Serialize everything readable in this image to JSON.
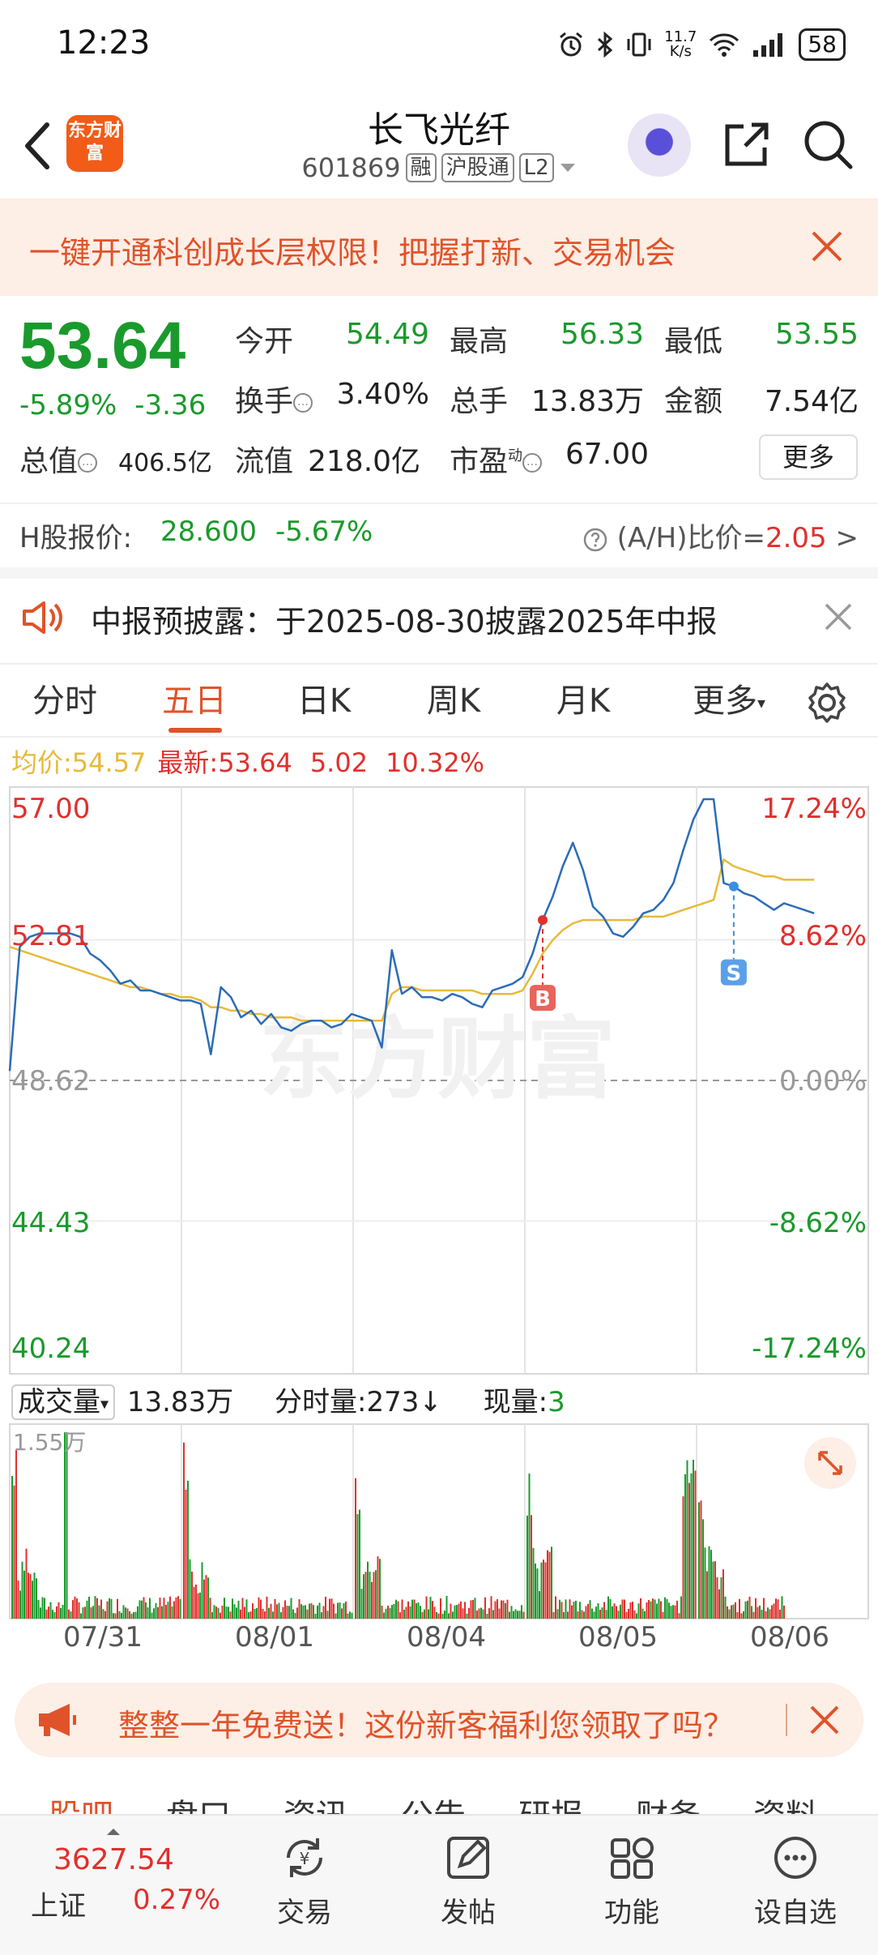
{
  "status_bar": {
    "time": "12:23",
    "net_speed_value": "11.7",
    "net_speed_unit": "K/s",
    "battery": "58",
    "icons": [
      "alarm-icon",
      "bluetooth-icon",
      "vibrate-icon",
      "wifi-icon",
      "signal-icon",
      "battery-icon"
    ]
  },
  "header": {
    "logo_text": "东方财富",
    "stock_name": "长飞光纤",
    "stock_code": "601869",
    "tag_margin": "融",
    "tag_connect": "沪股通",
    "tag_level": "L2"
  },
  "promo_banner": {
    "text": "一键开通科创成长层权限！把握打新、交易机会"
  },
  "quote": {
    "price": "53.64",
    "change_pct": "-5.89%",
    "change_amt": "-3.36",
    "open_label": "今开",
    "open_value": "54.49",
    "high_label": "最高",
    "high_value": "56.33",
    "low_label": "最低",
    "low_value": "53.55",
    "turnover_label": "换手",
    "turnover_value": "3.40%",
    "volume_label": "总手",
    "volume_value": "13.83万",
    "amount_label": "金额",
    "amount_value": "7.54亿",
    "mktcap_label": "总值",
    "mktcap_value": "406.5亿",
    "float_label": "流值",
    "float_value": "218.0亿",
    "pe_label": "市盈",
    "pe_sup": "动",
    "pe_value": "67.00",
    "more_label": "更多"
  },
  "hk": {
    "label": "H股报价:",
    "price": "28.600",
    "change": "-5.67%",
    "ratio_label": "(A/H)比价=",
    "ratio_value": "2.05",
    "ratio_arrow": ">"
  },
  "notice": {
    "text": "中报预披露：于2025-08-30披露2025年中报"
  },
  "tabs": {
    "items": [
      "分时",
      "五日",
      "日K",
      "周K",
      "月K",
      "更多"
    ],
    "active": "五日"
  },
  "chart_header": {
    "avg_label": "均价:",
    "avg_value": "54.57",
    "latest_label": "最新:",
    "latest_value": "53.64",
    "latest_chg": "5.02",
    "latest_pct": "10.32%"
  },
  "chart_data": {
    "type": "line",
    "watermark": "东方财富",
    "y_ticks_left": [
      "57.00",
      "52.81",
      "48.62",
      "44.43",
      "40.24"
    ],
    "y_ticks_right": [
      "17.24%",
      "8.62%",
      "0.00%",
      "-8.62%",
      "-17.24%"
    ],
    "ylim": [
      40.24,
      57.0
    ],
    "x_categories": [
      "07/31",
      "08/01",
      "08/04",
      "08/05",
      "08/06"
    ],
    "series": [
      {
        "values": [
          48.9,
          52.6,
          52.9,
          53.0,
          53.0,
          53.0,
          53.0,
          52.9,
          52.4,
          52.2,
          51.9,
          51.5,
          51.6,
          51.3,
          51.3,
          51.2,
          51.1,
          51.0,
          51.0,
          50.9,
          49.4,
          51.4,
          51.1,
          50.5,
          50.7,
          50.3,
          50.6,
          50.2,
          50.1,
          50.3,
          50.4,
          50.4,
          50.2,
          50.3,
          50.6,
          50.5,
          50.4,
          49.6,
          52.5,
          51.2,
          51.4,
          51.1,
          51.1,
          51.0,
          51.2,
          51.1,
          50.9,
          50.8,
          51.3,
          51.4,
          51.5,
          51.7,
          52.4,
          53.4,
          54.1,
          55.0,
          55.7,
          54.9,
          53.8,
          53.5,
          53.0,
          52.9,
          53.2,
          53.6,
          53.7,
          54.0,
          54.5,
          55.5,
          56.4,
          57.0,
          57.0,
          54.5,
          54.4,
          54.2,
          54.1,
          53.9,
          53.7,
          53.9,
          53.8,
          53.7,
          53.6
        ]
      },
      {
        "values": [
          52.6,
          52.5,
          52.4,
          52.3,
          52.2,
          52.1,
          52.0,
          51.9,
          51.8,
          51.7,
          51.6,
          51.5,
          51.4,
          51.4,
          51.3,
          51.2,
          51.2,
          51.1,
          51.1,
          51.0,
          50.8,
          50.8,
          50.7,
          50.7,
          50.6,
          50.6,
          50.5,
          50.5,
          50.5,
          50.4,
          50.4,
          50.4,
          50.4,
          50.4,
          50.4,
          50.4,
          50.4,
          50.4,
          51.2,
          51.4,
          51.4,
          51.3,
          51.3,
          51.3,
          51.3,
          51.3,
          51.3,
          51.2,
          51.2,
          51.2,
          51.2,
          51.3,
          51.8,
          52.4,
          52.8,
          53.1,
          53.3,
          53.4,
          53.4,
          53.4,
          53.4,
          53.4,
          53.4,
          53.5,
          53.5,
          53.5,
          53.6,
          53.7,
          53.8,
          53.9,
          54.0,
          55.2,
          55.0,
          54.9,
          54.8,
          54.7,
          54.7,
          54.6,
          54.6,
          54.6,
          54.6
        ]
      }
    ],
    "markers": [
      {
        "label": "B"
      },
      {
        "label": "S"
      }
    ],
    "volume": {
      "label": "成交量",
      "total": "13.83万",
      "tick_label": "分时量:273",
      "now_label": "现量:",
      "now_value": "3",
      "max_tick": "1.55万"
    }
  },
  "promo_banner2": {
    "text": "整整一年免费送！这份新客福利您领取了吗？"
  },
  "section_tabs": [
    "股吧",
    "盘口",
    "资讯",
    "公告",
    "研报",
    "财务",
    "资料"
  ],
  "bottom_nav": {
    "index_value": "3627.54",
    "index_name": "上证",
    "index_change": "0.27%",
    "items": [
      {
        "label": "交易",
        "icon": "trade-icon"
      },
      {
        "label": "发帖",
        "icon": "post-icon"
      },
      {
        "label": "功能",
        "icon": "apps-icon"
      },
      {
        "label": "设自选",
        "icon": "more-dots-icon"
      }
    ]
  },
  "colors": {
    "up": "#e0302d",
    "down": "#1a9a2c",
    "accent": "#e0532a",
    "price_line": "#2b6cb8",
    "avg_line": "#e8b93a"
  }
}
